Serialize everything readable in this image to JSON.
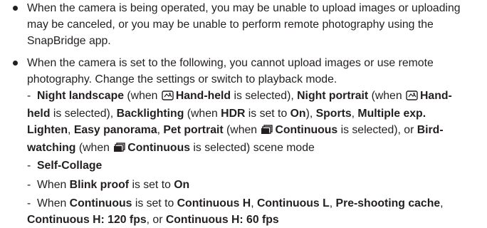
{
  "bullets": [
    {
      "text": "When the camera is being operated, you may be unable to upload images or uploading may be canceled, or you may be unable to perform remote photography using the SnapBridge app."
    },
    {
      "text": "When the camera is set to the following, you cannot upload images or use remote photography. Change the settings or switch to playback mode."
    }
  ],
  "sub_items": {
    "dash": "-",
    "scene": {
      "night_landscape": "Night landscape",
      "when_open": "(when ",
      "hand_held": "Hand-held",
      "is_selected_comma": "is selected),",
      "night_portrait": "Night portrait",
      "hand_part1": "Hand-",
      "held_part2": "held",
      "backlighting": "Backlighting",
      "when_plain": "(when",
      "hdr": "HDR",
      "is_set_to": "is set to",
      "on": "On",
      "close_paren_comma": "),",
      "sports": "Sports",
      "multiple_exp": "Multiple exp.",
      "lighten": "Lighten",
      "easy_panorama": "Easy panorama",
      "pet_portrait": "Pet portrait",
      "continuous": "Continuous",
      "is_selected_or": "is selected), or",
      "bird_part1": "Bird-",
      "watching_part2": "watching",
      "is_selected_end": "is selected) scene mode",
      "comma": ","
    },
    "self_collage": "Self-Collage",
    "blink": {
      "when": "When",
      "blink_proof": "Blink proof",
      "is_set_to": "is set to",
      "on": "On"
    },
    "continuous_line": {
      "when": "When",
      "continuous": "Continuous",
      "is_set_to": "is set to",
      "continuous_h": "Continuous H",
      "continuous_l": "Continuous L",
      "pre_shooting_cache": "Pre-shooting cache",
      "continuous_h_120": "Continuous H: 120 fps",
      "or": "or",
      "continuous_h_60": "Continuous H: 60 fps",
      "comma": ","
    }
  },
  "icons": {
    "hand_held_icon": "hand-held-scene-icon",
    "continuous_icon": "continuous-shooting-icon"
  }
}
